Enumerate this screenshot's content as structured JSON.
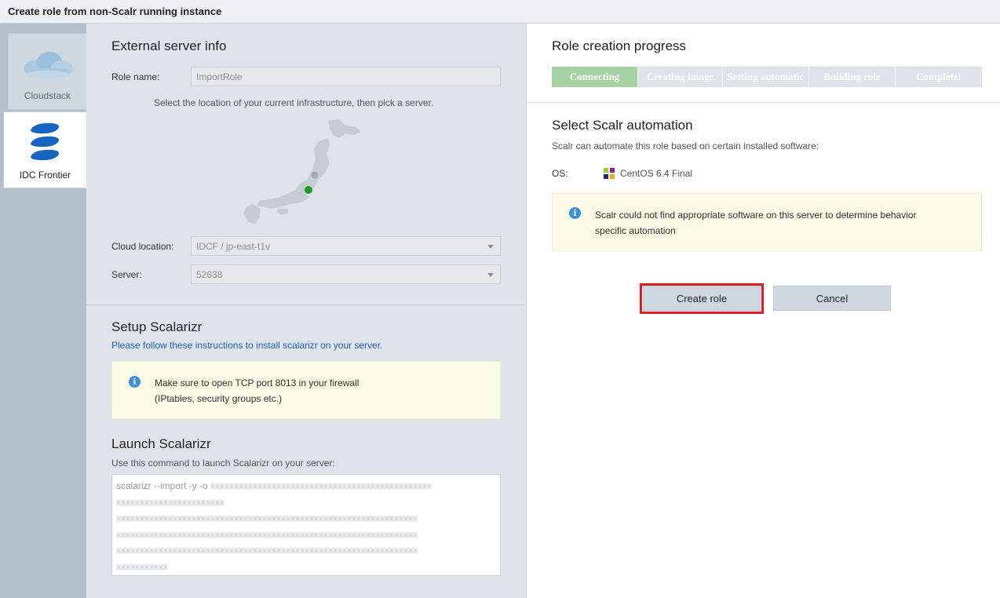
{
  "window": {
    "title": "Create role from non-Scalr running instance"
  },
  "sidebar": {
    "tabs": [
      {
        "label": "Cloudstack",
        "icon": "cloudstack-icon"
      },
      {
        "label": "IDC Frontier",
        "icon": "idc-frontier-icon"
      }
    ]
  },
  "external_server": {
    "title": "External server info",
    "role_name_label": "Role name:",
    "role_name_value": "ImportRole",
    "hint": "Select the location of your current infrastructure, then pick a server.",
    "cloud_location_label": "Cloud location:",
    "cloud_location_value": "IDCF / jp-east-t1v",
    "server_label": "Server:",
    "server_value": "52638"
  },
  "setup": {
    "title": "Setup Scalarizr",
    "link": "Please follow these instructions to install scalarizr on your server.",
    "info_line1": "Make sure to open TCP port 8013 in your firewall",
    "info_line2": "(IPtables, security groups etc.)"
  },
  "launch": {
    "title": "Launch Scalarizr",
    "label": "Use this command to launch Scalarizr on your server:",
    "command_prefix": "scalarizr --import -y -o"
  },
  "progress": {
    "title": "Role creation progress",
    "steps": [
      "Connecting",
      "Creating image",
      "Setting automatic",
      "Building role",
      "Complete!"
    ],
    "active_index": 0
  },
  "automation": {
    "title": "Select Scalr automation",
    "subtitle": "Scalr can automate this role based on certain installed software:",
    "os_label": "OS:",
    "os_value": "CentOS 6.4 Final",
    "info_line1": "Scalr could not find appropriate software on this server to determine behavior",
    "info_line2": "specific automation"
  },
  "buttons": {
    "create_role": "Create role",
    "cancel": "Cancel"
  },
  "colors": {
    "highlight_border": "#e21c23",
    "progress_done": "#a6d3a2",
    "info_icon": "#3c8fd9",
    "map_server_dot": "#1e9a2a"
  }
}
